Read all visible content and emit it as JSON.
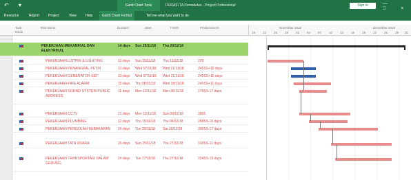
{
  "app": {
    "quick_access": "↶ ▾",
    "context_tab_group": "Gantt Chart Tools",
    "window_title": "DURASI TA Pemodelan - Project Professional",
    "sign_in": "Sign in",
    "win_controls": "— □ ×"
  },
  "tabs": [
    "Resource",
    "Report",
    "Project",
    "View",
    "Help",
    "Gantt Chart Format",
    "Tell me what you want to do"
  ],
  "columns": {
    "mode": "Task Mode",
    "name": "Task Name",
    "duration": "Duration",
    "start": "Start",
    "finish": "Finish",
    "pred": "Predecessors"
  },
  "timescale": {
    "week1": "November 2018",
    "week2": "December 2018",
    "days": [
      "19",
      "22",
      "25",
      "28",
      "01",
      "04",
      "07",
      "10",
      "13",
      "16",
      "19",
      "22",
      "25",
      "28",
      "31"
    ]
  },
  "rows": [
    {
      "name": "PEKERJAAN MEKANIKAL DAN ELEKTRIKAL",
      "duration": "14 days",
      "start": "Sun 25/11/18",
      "finish": "Thu 20/12/18",
      "pred": "",
      "summary": true
    },
    {
      "name": "PEKERJAAN LISTRIK & LIGHTING",
      "duration": "13 days",
      "start": "Sun 25/11/18",
      "finish": "Thu 13/12/18",
      "pred": "229",
      "summary": false
    },
    {
      "name": "PEKERJAAN PENANGKAL PETIR",
      "duration": "13 days",
      "start": "Wed 07/11/18",
      "finish": "Wed 21/11/18",
      "pred": "245SS+15 days",
      "summary": false
    },
    {
      "name": "PEKERJAAN GENERATOR SET",
      "duration": "13 days",
      "start": "Wed 07/11/18",
      "finish": "Wed 21/11/18",
      "pred": "245SS+15 days",
      "summary": false
    },
    {
      "name": "PEKERJAAN FIRE ALARM",
      "duration": "15 days",
      "start": "Thu 08/11/18",
      "finish": "Wed 28/11/18",
      "pred": "245SS+11 days",
      "summary": false
    },
    {
      "name": "PEKERJAAN SOUND SYSTEM PUBLIC ADDRESS",
      "duration": "11 days",
      "start": "Mon 12/11/18",
      "finish": "Mon 26/11/18",
      "pred": "278SS-17 days",
      "summary": false
    },
    {
      "name": "PEKERJAAN CCTV",
      "duration": "21 days",
      "start": "Mon 12/11/18",
      "finish": "Sun 09/12/18",
      "pred": "2855",
      "summary": false
    },
    {
      "name": "PEKERJAAN PLUMBING",
      "duration": "12 days",
      "start": "Thu 15/11/18",
      "finish": "Thu 06/12/18",
      "pred": "288SS-16 days",
      "summary": false
    },
    {
      "name": "PEKERJAAN PENGOLAH KEBAKARAN",
      "duration": "24 days",
      "start": "Tue 20/11/18",
      "finish": "Sat 29/12/18",
      "pred": "300SS-17 days",
      "summary": false
    },
    {
      "name": "PEKERJAAN TATA UDARA",
      "duration": "26 days",
      "start": "Sun 25/11/18",
      "finish": "Thu 27/12/18",
      "pred": "318SS-11 days",
      "summary": false
    },
    {
      "name": "PEKERJAAN TRANSPORTASI DALAM GEDUNG",
      "duration": "24 days",
      "start": "Tue 27/11/18",
      "finish": "Thu 27/12/18",
      "pred": "334SS-16 days",
      "summary": false
    }
  ]
}
